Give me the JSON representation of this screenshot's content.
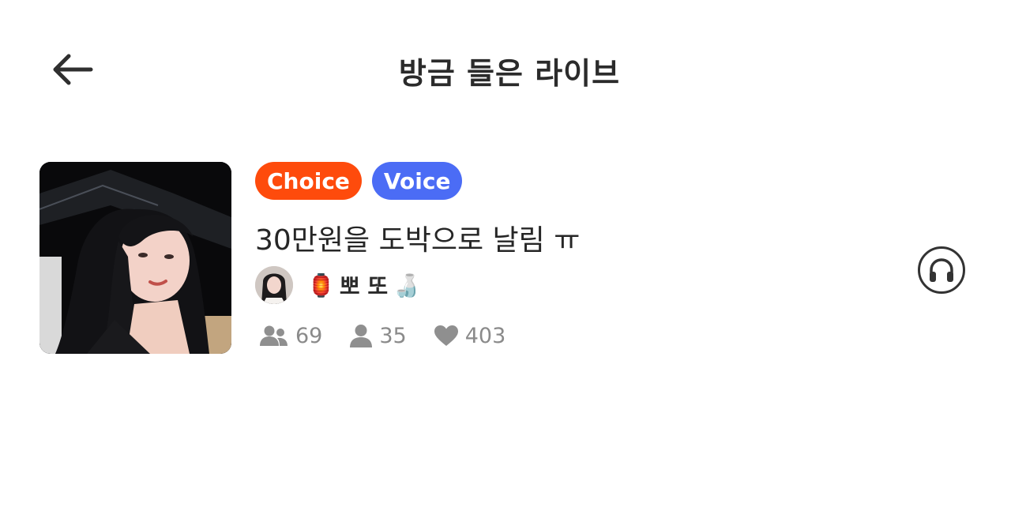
{
  "header": {
    "title": "방금 들은 라이브",
    "back_icon": "arrow-left-icon"
  },
  "live": {
    "thumbnail_alt": "streamer-photo",
    "badges": {
      "choice": {
        "label": "Choice",
        "color": "#fe4b0c"
      },
      "voice": {
        "label": "Voice",
        "color": "#4b6cf5"
      }
    },
    "title": "30만원을 도박으로 날림 ㅠ",
    "host": {
      "prefix_emoji": "🏮",
      "name": "뽀 또",
      "suffix_emoji": "🍶"
    },
    "stats": {
      "listeners": "69",
      "fans": "35",
      "likes": "403"
    },
    "listen_icon": "headphones-icon"
  }
}
